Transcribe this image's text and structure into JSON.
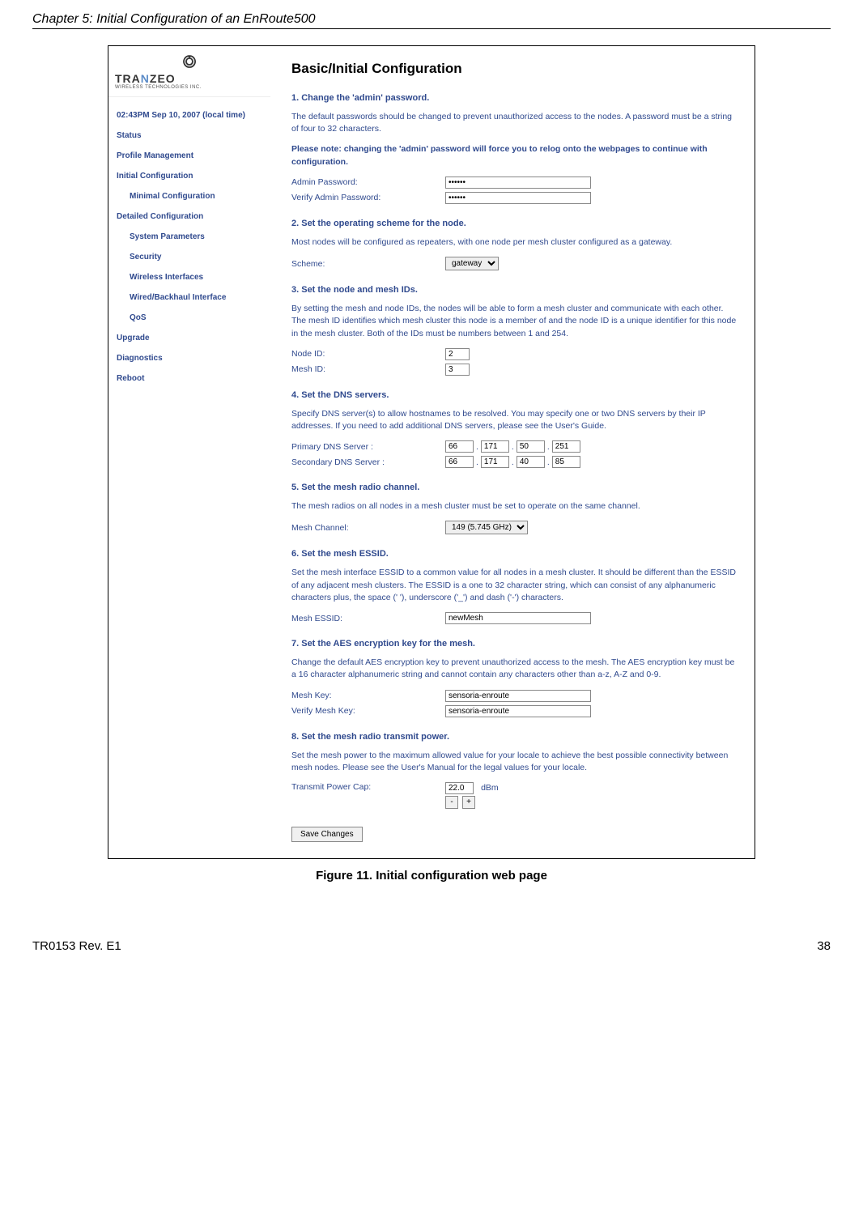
{
  "document": {
    "chapter_title": "Chapter 5: Initial Configuration of an EnRoute500",
    "figure_caption": "Figure 11. Initial configuration web page",
    "footer_left": "TR0153 Rev. E1",
    "footer_right": "38"
  },
  "logo": {
    "brand": "TRANZEO",
    "tagline": "WIRELESS TECHNOLOGIES INC."
  },
  "sidebar": {
    "timestamp": "02:43PM Sep 10, 2007 (local time)",
    "items": [
      {
        "label": "Status",
        "indent": false
      },
      {
        "label": "Profile Management",
        "indent": false
      },
      {
        "label": "Initial Configuration",
        "indent": false
      },
      {
        "label": "Minimal Configuration",
        "indent": true
      },
      {
        "label": "Detailed Configuration",
        "indent": false
      },
      {
        "label": "System Parameters",
        "indent": true
      },
      {
        "label": "Security",
        "indent": true
      },
      {
        "label": "Wireless Interfaces",
        "indent": true
      },
      {
        "label": "Wired/Backhaul Interface",
        "indent": true
      },
      {
        "label": "QoS",
        "indent": true
      },
      {
        "label": "Upgrade",
        "indent": false
      },
      {
        "label": "Diagnostics",
        "indent": false
      },
      {
        "label": "Reboot",
        "indent": false
      }
    ]
  },
  "main": {
    "title": "Basic/Initial Configuration",
    "s1": {
      "title": "1. Change the 'admin' password.",
      "p1": "The default passwords should be changed to prevent unauthorized access to the nodes. A password must be a string of four to 32 characters.",
      "note": "Please note: changing the 'admin' password will force you to relog onto the webpages to continue with configuration.",
      "admin_label": "Admin Password:",
      "verify_label": "Verify Admin Password:",
      "admin_value": "••••••",
      "verify_value": "••••••"
    },
    "s2": {
      "title": "2. Set the operating scheme for the node.",
      "p1": "Most nodes will be configured as repeaters, with one node per mesh cluster configured as a gateway.",
      "scheme_label": "Scheme:",
      "scheme_value": "gateway"
    },
    "s3": {
      "title": "3. Set the node and mesh IDs.",
      "p1": "By setting the mesh and node IDs, the nodes will be able to form a mesh cluster and communicate with each other. The mesh ID identifies which mesh cluster this node is a member of and the node ID is a unique identifier for this node in the mesh cluster. Both of the IDs must be numbers between 1 and 254.",
      "node_label": "Node ID:",
      "mesh_label": "Mesh ID:",
      "node_value": "2",
      "mesh_value": "3"
    },
    "s4": {
      "title": "4. Set the DNS servers.",
      "p1": "Specify DNS server(s) to allow hostnames to be resolved. You may specify one or two DNS servers by their IP addresses. If you need to add additional DNS servers, please see the User's Guide.",
      "primary_label": "Primary DNS Server :",
      "secondary_label": "Secondary DNS Server :",
      "primary": [
        "66",
        "171",
        "50",
        "251"
      ],
      "secondary": [
        "66",
        "171",
        "40",
        "85"
      ]
    },
    "s5": {
      "title": "5. Set the mesh radio channel.",
      "p1": "The mesh radios on all nodes in a mesh cluster must be set to operate on the same channel.",
      "channel_label": "Mesh Channel:",
      "channel_value": "149 (5.745 GHz)"
    },
    "s6": {
      "title": "6. Set the mesh ESSID.",
      "p1": "Set the mesh interface ESSID to a common value for all nodes in a mesh cluster. It should be different than the ESSID of any adjacent mesh clusters. The ESSID is a one to 32 character string, which can consist of any alphanumeric characters plus, the space (' '), underscore ('_') and dash ('-') characters.",
      "essid_label": "Mesh ESSID:",
      "essid_value": "newMesh"
    },
    "s7": {
      "title": "7. Set the AES encryption key for the mesh.",
      "p1": "Change the default AES encryption key to prevent unauthorized access to the mesh. The AES encryption key must be a 16 character alphanumeric string and cannot contain any characters other than a-z, A-Z and 0-9.",
      "key_label": "Mesh Key:",
      "verify_label": "Verify Mesh Key:",
      "key_value": "sensoria-enroute",
      "verify_value": "sensoria-enroute"
    },
    "s8": {
      "title": "8. Set the mesh radio transmit power.",
      "p1": "Set the mesh power to the maximum allowed value for your locale to achieve the best possible connectivity between mesh nodes. Please see the User's Manual for the legal values for your locale.",
      "power_label": "Transmit Power Cap:",
      "power_value": "22.0",
      "unit": "dBm",
      "minus": "-",
      "plus": "+"
    },
    "save_label": "Save Changes"
  }
}
